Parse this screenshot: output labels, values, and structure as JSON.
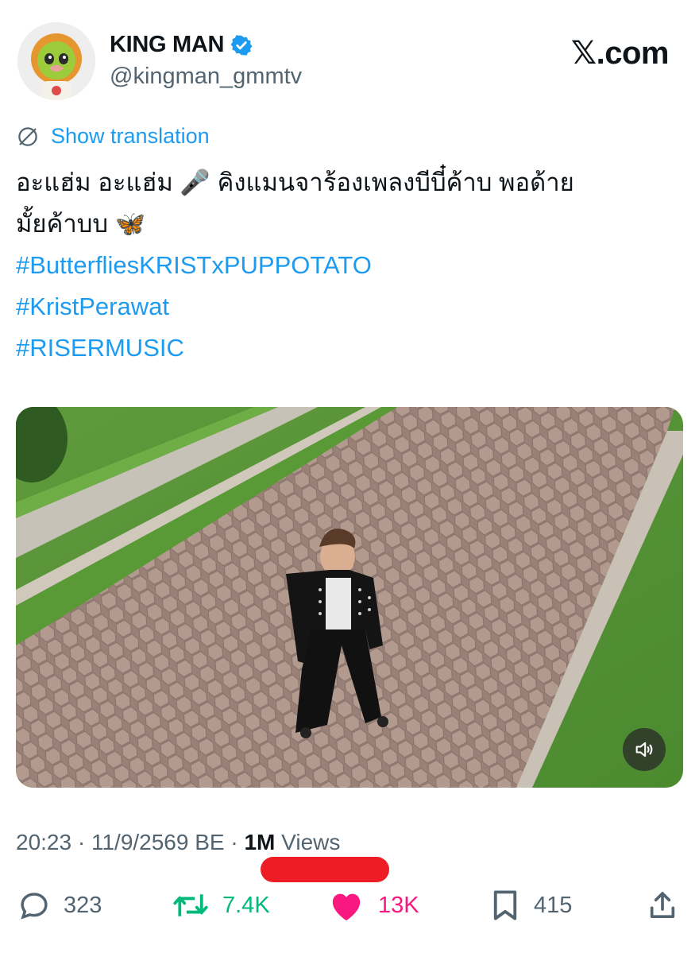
{
  "header": {
    "display_name": "KING MAN",
    "handle": "@kingman_gmmtv",
    "verified_icon": "verified-badge-icon",
    "brand": "𝕏.com"
  },
  "translation": {
    "label": "Show translation",
    "icon": "translate-globe-icon"
  },
  "tweet": {
    "line1": "อะแฮ่ม อะแฮ่ม 🎤 คิงแมนจาร้องเพลงบีบี๋ค้าบ พอด้าย",
    "line2": "มั้ยค้าบบ 🦋",
    "hashtags": [
      "#ButterfliesKRISTxPUPPOTATO",
      "#KristPerawat",
      "#RISERMUSIC"
    ]
  },
  "media": {
    "type": "video",
    "mute_icon": "speaker-muted-icon"
  },
  "meta": {
    "time": "20:23",
    "date": "11/9/2569 BE",
    "separator": "·",
    "views_count": "1M",
    "views_label": "Views"
  },
  "actions": {
    "replies": "323",
    "reposts": "7.4K",
    "likes": "13K",
    "bookmarks": "415"
  },
  "colors": {
    "accent": "#1d9bf0",
    "repost": "#00ba7c",
    "like": "#f91880",
    "muted_text": "#536471",
    "redaction": "#ee1d25"
  }
}
